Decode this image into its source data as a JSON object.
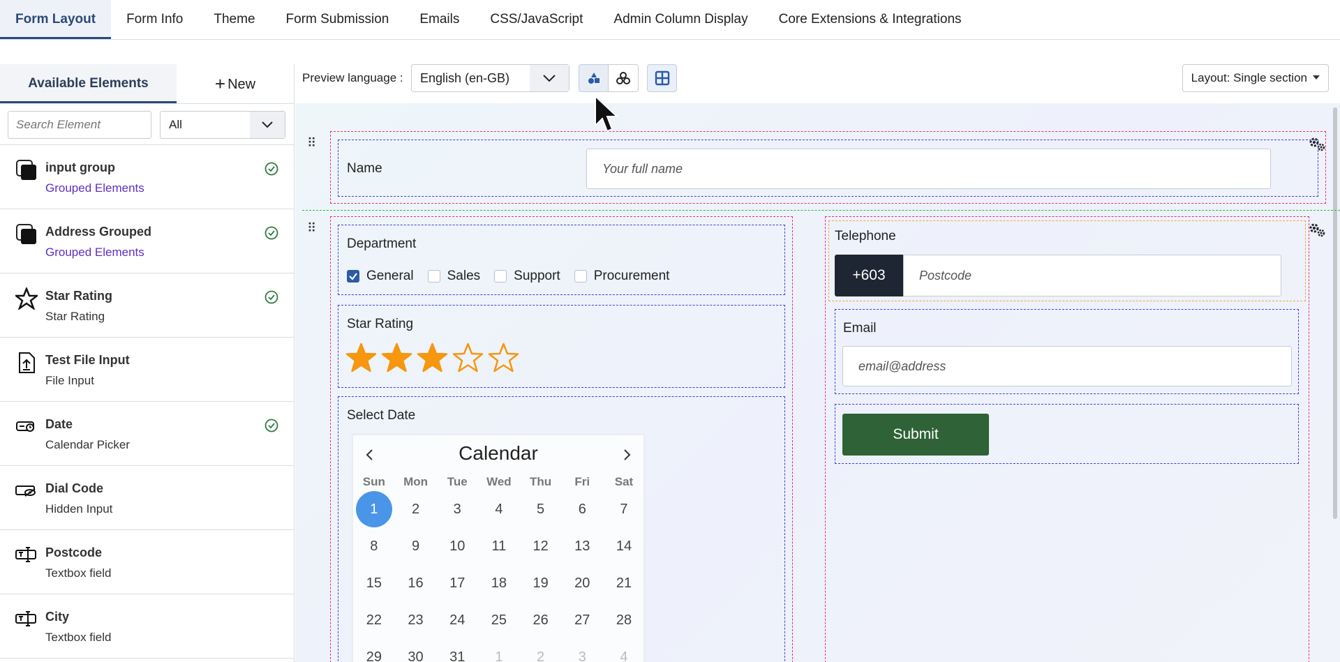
{
  "top_tabs": [
    {
      "label": "Form Layout",
      "active": true
    },
    {
      "label": "Form Info"
    },
    {
      "label": "Theme"
    },
    {
      "label": "Form Submission"
    },
    {
      "label": "Emails"
    },
    {
      "label": "CSS/JavaScript"
    },
    {
      "label": "Admin Column Display"
    },
    {
      "label": "Core Extensions & Integrations"
    }
  ],
  "sidebar": {
    "tab_label": "Available Elements",
    "new_label": "New",
    "search_placeholder": "Search Element",
    "filter_value": "All",
    "elements": [
      {
        "title": "input group",
        "subtitle": "Grouped Elements",
        "icon": "grouped-square-icon",
        "checked": true
      },
      {
        "title": "Address Grouped",
        "subtitle": "Grouped Elements",
        "icon": "grouped-square-icon",
        "checked": true
      },
      {
        "title": "Star Rating",
        "subtitle": "Star Rating",
        "icon": "star-icon",
        "checked": true
      },
      {
        "title": "Test File Input",
        "subtitle": "File Input",
        "icon": "file-upload-icon",
        "checked": false
      },
      {
        "title": "Date",
        "subtitle": "Calendar Picker",
        "icon": "calendar-picker-icon",
        "checked": true
      },
      {
        "title": "Dial Code",
        "subtitle": "Hidden Input",
        "icon": "hidden-input-icon",
        "checked": false
      },
      {
        "title": "Postcode",
        "subtitle": "Textbox field",
        "icon": "textbox-icon",
        "checked": false
      },
      {
        "title": "City",
        "subtitle": "Textbox field",
        "icon": "textbox-icon",
        "checked": false
      }
    ]
  },
  "toolbar": {
    "preview_label": "Preview language :",
    "language": "English (en-GB)",
    "layout_label": "Layout: Single section"
  },
  "form": {
    "name_label": "Name",
    "name_placeholder": "Your full name",
    "department_label": "Department",
    "departments": [
      {
        "label": "General",
        "checked": true
      },
      {
        "label": "Sales",
        "checked": false
      },
      {
        "label": "Support",
        "checked": false
      },
      {
        "label": "Procurement",
        "checked": false
      }
    ],
    "star_label": "Star Rating",
    "star_rating": 3,
    "star_max": 5,
    "date_label": "Select Date",
    "telephone_label": "Telephone",
    "dial_code": "+603",
    "postcode_placeholder": "Postcode",
    "email_label": "Email",
    "email_placeholder": "email@address",
    "submit_label": "Submit"
  },
  "calendar": {
    "title": "Calendar",
    "weekdays": [
      "Sun",
      "Mon",
      "Tue",
      "Wed",
      "Thu",
      "Fri",
      "Sat"
    ],
    "days": [
      "1",
      "2",
      "3",
      "4",
      "5",
      "6",
      "7",
      "8",
      "9",
      "10",
      "11",
      "12",
      "13",
      "14",
      "15",
      "16",
      "17",
      "18",
      "19",
      "20",
      "21",
      "22",
      "23",
      "24",
      "25",
      "26",
      "27",
      "28",
      "29",
      "30",
      "31",
      "1",
      "2",
      "3",
      "4"
    ],
    "selected_day": "1",
    "muted_from_index": 31
  },
  "colors": {
    "accent": "#2c4a78",
    "star": "#f7960f",
    "submit": "#2f6237",
    "selected_day": "#4b95e8"
  }
}
